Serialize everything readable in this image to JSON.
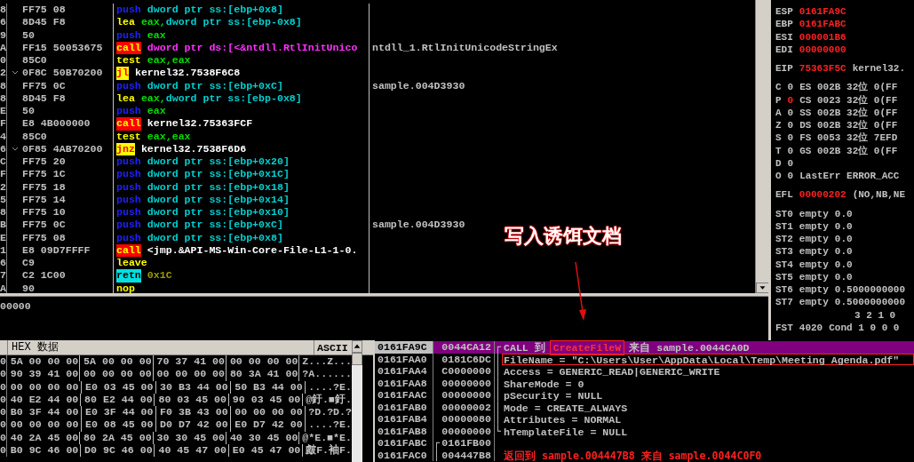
{
  "disassembly": {
    "rows": [
      {
        "addr": "8",
        "bytes": "FF75 08",
        "jump": false,
        "mnemonic": "push",
        "kind": "push",
        "operands": [
          {
            "text": "dword ptr ss:[ebp+0x8]",
            "kind": "mem"
          }
        ]
      },
      {
        "addr": "6",
        "bytes": "8D45 F8",
        "jump": false,
        "mnemonic": "lea",
        "kind": "plain",
        "operands": [
          {
            "text": "eax,",
            "kind": "reg"
          },
          {
            "text": "dword ptr ss:[ebp-0x8]",
            "kind": "mem"
          }
        ]
      },
      {
        "addr": "9",
        "bytes": "50",
        "jump": false,
        "mnemonic": "push",
        "kind": "push",
        "operands": [
          {
            "text": "eax",
            "kind": "reg"
          }
        ]
      },
      {
        "addr": "A",
        "bytes": "FF15 50053675",
        "jump": false,
        "mnemonic": "call",
        "kind": "call",
        "operands": [
          {
            "text": "dword ptr ds:[<&ntdll.RtlInitUnico",
            "kind": "api"
          }
        ],
        "comment": "ntdll_1.RtlInitUnicodeStringEx"
      },
      {
        "addr": "0",
        "bytes": "85C0",
        "jump": false,
        "mnemonic": "test",
        "kind": "plain",
        "operands": [
          {
            "text": "eax,eax",
            "kind": "reg"
          }
        ]
      },
      {
        "addr": "2",
        "bytes": "0F8C 50B70200",
        "jump": true,
        "mnemonic": "jl",
        "kind": "jump",
        "operands": [
          {
            "text": "kernel32.7538F6C8",
            "kind": "label"
          }
        ]
      },
      {
        "addr": "8",
        "bytes": "FF75 0C",
        "jump": false,
        "mnemonic": "push",
        "kind": "push",
        "operands": [
          {
            "text": "dword ptr ss:[ebp+0xC]",
            "kind": "mem"
          }
        ],
        "comment": "sample.004D3930"
      },
      {
        "addr": "8",
        "bytes": "8D45 F8",
        "jump": false,
        "mnemonic": "lea",
        "kind": "plain",
        "operands": [
          {
            "text": "eax,",
            "kind": "reg"
          },
          {
            "text": "dword ptr ss:[ebp-0x8]",
            "kind": "mem"
          }
        ]
      },
      {
        "addr": "E",
        "bytes": "50",
        "jump": false,
        "mnemonic": "push",
        "kind": "push",
        "operands": [
          {
            "text": "eax",
            "kind": "reg"
          }
        ]
      },
      {
        "addr": "F",
        "bytes": "E8 4B000000",
        "jump": false,
        "mnemonic": "call",
        "kind": "call",
        "operands": [
          {
            "text": "kernel32.75363FCF",
            "kind": "label"
          }
        ]
      },
      {
        "addr": "4",
        "bytes": "85C0",
        "jump": false,
        "mnemonic": "test",
        "kind": "plain",
        "operands": [
          {
            "text": "eax,eax",
            "kind": "reg"
          }
        ]
      },
      {
        "addr": "6",
        "bytes": "0F85 4AB70200",
        "jump": true,
        "mnemonic": "jnz",
        "kind": "jump",
        "operands": [
          {
            "text": "kernel32.7538F6D6",
            "kind": "label"
          }
        ]
      },
      {
        "addr": "C",
        "bytes": "FF75 20",
        "jump": false,
        "mnemonic": "push",
        "kind": "push",
        "operands": [
          {
            "text": "dword ptr ss:[ebp+0x20]",
            "kind": "mem"
          }
        ]
      },
      {
        "addr": "F",
        "bytes": "FF75 1C",
        "jump": false,
        "mnemonic": "push",
        "kind": "push",
        "operands": [
          {
            "text": "dword ptr ss:[ebp+0x1C]",
            "kind": "mem"
          }
        ]
      },
      {
        "addr": "2",
        "bytes": "FF75 18",
        "jump": false,
        "mnemonic": "push",
        "kind": "push",
        "operands": [
          {
            "text": "dword ptr ss:[ebp+0x18]",
            "kind": "mem"
          }
        ]
      },
      {
        "addr": "5",
        "bytes": "FF75 14",
        "jump": false,
        "mnemonic": "push",
        "kind": "push",
        "operands": [
          {
            "text": "dword ptr ss:[ebp+0x14]",
            "kind": "mem"
          }
        ]
      },
      {
        "addr": "8",
        "bytes": "FF75 10",
        "jump": false,
        "mnemonic": "push",
        "kind": "push",
        "operands": [
          {
            "text": "dword ptr ss:[ebp+0x10]",
            "kind": "mem"
          }
        ]
      },
      {
        "addr": "B",
        "bytes": "FF75 0C",
        "jump": false,
        "mnemonic": "push",
        "kind": "push",
        "operands": [
          {
            "text": "dword ptr ss:[ebp+0xC]",
            "kind": "mem"
          }
        ],
        "comment": "sample.004D3930"
      },
      {
        "addr": "E",
        "bytes": "FF75 08",
        "jump": false,
        "mnemonic": "push",
        "kind": "push",
        "operands": [
          {
            "text": "dword ptr ss:[ebp+0x8]",
            "kind": "mem"
          }
        ]
      },
      {
        "addr": "1",
        "bytes": "E8 09D7FFFF",
        "jump": false,
        "mnemonic": "call",
        "kind": "call",
        "operands": [
          {
            "text": "<jmp.&API-MS-Win-Core-File-L1-1-0.",
            "kind": "label"
          }
        ]
      },
      {
        "addr": "6",
        "bytes": "C9",
        "jump": false,
        "mnemonic": "leave",
        "kind": "plain",
        "operands": []
      },
      {
        "addr": "7",
        "bytes": "C2 1C00",
        "jump": false,
        "mnemonic": "retn",
        "kind": "ret",
        "operands": [
          {
            "text": "0x1C",
            "kind": "imm"
          }
        ]
      },
      {
        "addr": "A",
        "bytes": "90",
        "jump": false,
        "mnemonic": "nop",
        "kind": "plain",
        "operands": []
      }
    ]
  },
  "annotation": {
    "text": "写入诱饵文档"
  },
  "info_pane": {
    "text": "00000"
  },
  "registers": {
    "groups": [
      [
        {
          "name": "ESP",
          "value": "0161FA9C",
          "changed": true
        },
        {
          "name": "EBP",
          "value": "0161FABC",
          "changed": true
        },
        {
          "name": "ESI",
          "value": "000001B6",
          "changed": true
        },
        {
          "name": "EDI",
          "value": "00000000",
          "changed": true
        }
      ],
      [
        {
          "name": "EIP",
          "value": "75363F5C",
          "changed": true,
          "note": "kernel32."
        }
      ],
      [
        {
          "name": "C",
          "value": "0",
          "changed": false,
          "note": "ES 002B 32位 0(FF"
        },
        {
          "name": "P",
          "value": "0",
          "changed": true,
          "note": "CS 0023 32位 0(FF"
        },
        {
          "name": "A",
          "value": "0",
          "changed": false,
          "note": "SS 002B 32位 0(FF"
        },
        {
          "name": "Z",
          "value": "0",
          "changed": false,
          "note": "DS 002B 32位 0(FF"
        },
        {
          "name": "S",
          "value": "0",
          "changed": false,
          "note": "FS 0053 32位 7EFD"
        },
        {
          "name": "T",
          "value": "0",
          "changed": false,
          "note": "GS 002B 32位 0(FF"
        },
        {
          "name": "D",
          "value": "0",
          "changed": false
        },
        {
          "name": "O",
          "value": "0",
          "changed": false,
          "note": "LastErr ERROR_ACC"
        }
      ],
      [
        {
          "name": "EFL",
          "value": "00000202",
          "changed": true,
          "note": "(NO,NB,NE"
        }
      ],
      [
        {
          "name": "ST0",
          "value": "empty",
          "changed": false,
          "note": "0.0"
        },
        {
          "name": "ST1",
          "value": "empty",
          "changed": false,
          "note": "0.0"
        },
        {
          "name": "ST2",
          "value": "empty",
          "changed": false,
          "note": "0.0"
        },
        {
          "name": "ST3",
          "value": "empty",
          "changed": false,
          "note": "0.0"
        },
        {
          "name": "ST4",
          "value": "empty",
          "changed": false,
          "note": "0.0"
        },
        {
          "name": "ST5",
          "value": "empty",
          "changed": false,
          "note": "0.0"
        },
        {
          "name": "ST6",
          "value": "empty",
          "changed": false,
          "note": "0.5000000000"
        },
        {
          "name": "ST7",
          "value": "empty",
          "changed": false,
          "note": "0.5000000000"
        },
        {
          "note": "3 2 1 0"
        },
        {
          "name": "FST",
          "value": "4020",
          "changed": false,
          "note": "Cond 1 0 0 0"
        }
      ]
    ]
  },
  "hex_dump": {
    "headers": [
      "HEX 数据",
      "ASCII"
    ],
    "rows": [
      {
        "addr": "0",
        "groups": [
          "5A 00 00 00",
          "5A 00 00 00",
          "70 37 41 00",
          "00 00 00 00"
        ],
        "ascii": "Z...Z..."
      },
      {
        "addr": "0",
        "groups": [
          "90 39 41 00",
          "00 00 00 00",
          "00 00 00 00",
          "80 3A 41 00"
        ],
        "ascii": "?A......"
      },
      {
        "addr": "0",
        "groups": [
          "00 00 00 00",
          "E0 03 45 00",
          "30 B3 44 00",
          "50 B3 44 00"
        ],
        "ascii": "....?E."
      },
      {
        "addr": "0",
        "groups": [
          "40 E2 44 00",
          "80 E2 44 00",
          "80 03 45 00",
          "90 03 45 00"
        ],
        "ascii": "@釪.■釪."
      },
      {
        "addr": "0",
        "groups": [
          "B0 3F 44 00",
          "E0 3F 44 00",
          "F0 3B 43 00",
          "00 00 00 00"
        ],
        "ascii": "?D.?D.?"
      },
      {
        "addr": "0",
        "groups": [
          "00 00 00 00",
          "E0 08 45 00",
          "D0 D7 42 00",
          "E0 D7 42 00"
        ],
        "ascii": "....?E."
      },
      {
        "addr": "0",
        "groups": [
          "40 2A 45 00",
          "80 2A 45 00",
          "30 30 45 00",
          "40 30 45 00"
        ],
        "ascii": "@*E.■*E."
      },
      {
        "addr": "0",
        "groups": [
          "B0 9C 46 00",
          "D0 9C 46 00",
          "40 45 47 00",
          "E0 45 47 00"
        ],
        "ascii": "皻F.袖F."
      }
    ]
  },
  "stack": {
    "rows": [
      {
        "addr": "0161FA9C",
        "value": "0044CA12",
        "selected": true,
        "bracket": "┌",
        "boxed": false,
        "comment": [
          {
            "text": "CALL 到 ",
            "kind": "plain",
            "boxed": false
          },
          {
            "text": "CreateFileW",
            "kind": "api",
            "boxed": true
          },
          {
            "text": " 来自 sample.0044CA0D",
            "kind": "plain",
            "boxed": false
          }
        ]
      },
      {
        "addr": "0161FAA0",
        "value": "0181C6DC",
        "selected": false,
        "bracket": "│",
        "boxed": true,
        "comment": [
          {
            "text": "FileName = \"C:\\Users\\User\\AppData\\Local\\Temp\\Meeting Agenda.pdf\"",
            "kind": "plain",
            "boxed": false
          }
        ]
      },
      {
        "addr": "0161FAA4",
        "value": "C0000000",
        "selected": false,
        "bracket": "│",
        "boxed": false,
        "comment": [
          {
            "text": "Access = GENERIC_READ|GENERIC_WRITE",
            "kind": "plain",
            "boxed": false
          }
        ]
      },
      {
        "addr": "0161FAA8",
        "value": "00000000",
        "selected": false,
        "bracket": "│",
        "boxed": false,
        "comment": [
          {
            "text": "ShareMode = 0",
            "kind": "plain",
            "boxed": false
          }
        ]
      },
      {
        "addr": "0161FAAC",
        "value": "00000000",
        "selected": false,
        "bracket": "│",
        "boxed": false,
        "comment": [
          {
            "text": "pSecurity = NULL",
            "kind": "plain",
            "boxed": false
          }
        ]
      },
      {
        "addr": "0161FAB0",
        "value": "00000002",
        "selected": false,
        "bracket": "│",
        "boxed": false,
        "comment": [
          {
            "text": "Mode = CREATE_ALWAYS",
            "kind": "plain",
            "boxed": false
          }
        ]
      },
      {
        "addr": "0161FAB4",
        "value": "00000080",
        "selected": false,
        "bracket": "│",
        "boxed": false,
        "comment": [
          {
            "text": "Attributes = NORMAL",
            "kind": "plain",
            "boxed": false
          }
        ]
      },
      {
        "addr": "0161FAB8",
        "value": "00000000",
        "selected": false,
        "bracket": "└",
        "boxed": false,
        "comment": [
          {
            "text": "hTemplateFile = NULL",
            "kind": "plain",
            "boxed": false
          }
        ]
      },
      {
        "addr": "0161FABC",
        "value": "0161FB00",
        "selected": false,
        "value_bracket": "┌"
      },
      {
        "addr": "0161FAC0",
        "value": "004447B8",
        "selected": false,
        "value_bracket": "│",
        "boxed": false,
        "comment": [
          {
            "text": "返回到 sample.004447B8 来自 sample.0044C0F0",
            "kind": "return",
            "boxed": false
          }
        ]
      }
    ]
  }
}
